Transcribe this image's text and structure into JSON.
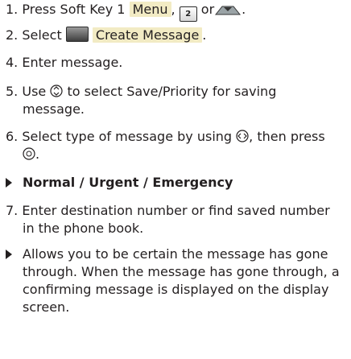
{
  "steps": {
    "s1": {
      "num": "1.",
      "text": "Press Soft Key 1",
      "menu": "Menu",
      "sep": ",",
      "key_label": "2",
      "or": "or",
      "end": "."
    },
    "s2": {
      "num": "2.",
      "text": "Select",
      "create": "Create Message",
      "end": "."
    },
    "s4": {
      "num": "4.",
      "text": "Enter message."
    },
    "s5": {
      "num": "5.",
      "text_a": "Use",
      "text_b": "to select Save/Priority for saving",
      "text_c": "message."
    },
    "s6": {
      "num": "6.",
      "text_a": "Select type of message by using",
      "text_b": ", then press",
      "text_c": "."
    },
    "bullet1": "Normal / Urgent / Emergency",
    "s7": {
      "num": "7.",
      "line1": "Enter destination number or find saved number",
      "line2": "in the phone book."
    },
    "bullet2": {
      "l1": "Allows you to be certain the message has gone",
      "l2": "through. When the message has gone through, a",
      "l3": "confirming message is displayed on the display",
      "l4": "screen."
    }
  },
  "colors": {
    "highlight": "#f2ebc4",
    "text": "#231f20"
  },
  "icons": [
    "key-2-icon",
    "message-key-icon",
    "navigation-key-icon",
    "scroll-key-icon",
    "nav-key-icon",
    "ok-key-icon"
  ]
}
